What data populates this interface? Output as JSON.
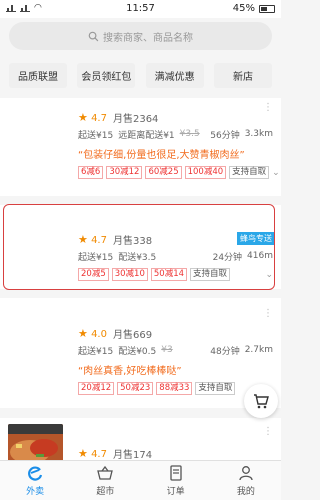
{
  "status": {
    "time": "11:57",
    "battery": "45%"
  },
  "search": {
    "placeholder": "搜索商家、商品名称"
  },
  "chips": [
    "品质联盟",
    "会员领红包",
    "满减优惠",
    "新店"
  ],
  "stores": [
    {
      "rating": "4.7",
      "sales": "月售2364",
      "min_order": "起送¥15",
      "delivery": "远距离配送¥1",
      "original_fee": "¥3.5",
      "time": "56分钟",
      "distance": "3.3km",
      "quote": "“包装仔细,份量也很足,大赞青椒肉丝”",
      "tags": [
        "6减6",
        "30减12",
        "60减25",
        "100减40"
      ],
      "pickup": "支持自取"
    },
    {
      "rating": "4.7",
      "sales": "月售338",
      "badge": "蜂鸟专送",
      "min_order": "起送¥15",
      "delivery": "配送¥3.5",
      "time": "24分钟",
      "distance": "416m",
      "tags": [
        "20减5",
        "30减10",
        "50减14"
      ],
      "pickup": "支持自取"
    },
    {
      "rating": "4.0",
      "sales": "月售669",
      "min_order": "起送¥15",
      "delivery": "配送¥0.5",
      "original_fee": "¥3",
      "time": "48分钟",
      "distance": "2.7km",
      "quote": "“肉丝真香,好吃棒棒哒”",
      "tags": [
        "20减12",
        "50减23",
        "88减33"
      ],
      "pickup": "支持自取"
    },
    {
      "rating": "4.7",
      "sales": "月售174"
    }
  ],
  "tabs": [
    {
      "label": "外卖",
      "icon": "eleme-icon"
    },
    {
      "label": "超市",
      "icon": "basket-icon"
    },
    {
      "label": "订单",
      "icon": "order-icon"
    },
    {
      "label": "我的",
      "icon": "user-icon"
    }
  ],
  "colors": {
    "accent": "#1a8de8",
    "star": "#f08a00",
    "promo": "#ee3333",
    "quote": "#f26b1d",
    "badge": "#2aa7e8"
  }
}
